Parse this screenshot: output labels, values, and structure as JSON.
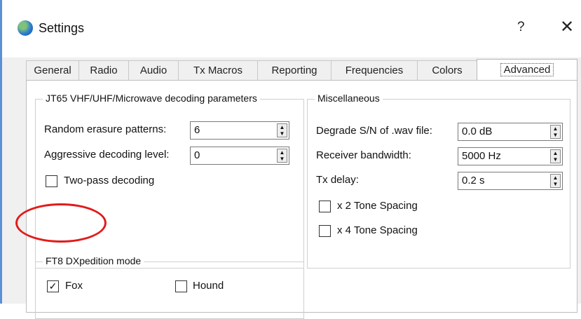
{
  "window": {
    "title": "Settings",
    "help_label": "?",
    "close_label": "✕"
  },
  "tabs": [
    {
      "label": "General",
      "active": false
    },
    {
      "label": "Radio",
      "active": false
    },
    {
      "label": "Audio",
      "active": false
    },
    {
      "label": "Tx Macros",
      "active": false
    },
    {
      "label": "Reporting",
      "active": false
    },
    {
      "label": "Frequencies",
      "active": false
    },
    {
      "label": "Colors",
      "active": false
    },
    {
      "label": "Advanced",
      "active": true
    }
  ],
  "jt65_group": {
    "title": "JT65 VHF/UHF/Microwave decoding parameters",
    "random_erasure_label": "Random erasure patterns:",
    "random_erasure_value": "6",
    "aggressive_label": "Aggressive decoding level:",
    "aggressive_value": "0",
    "two_pass_label": "Two-pass decoding",
    "two_pass_checked": false
  },
  "misc_group": {
    "title": "Miscellaneous",
    "degrade_label": "Degrade S/N of .wav file:",
    "degrade_value": "0.0 dB",
    "bandwidth_label": "Receiver bandwidth:",
    "bandwidth_value": "5000 Hz",
    "txdelay_label": "Tx delay:",
    "txdelay_value": "0.2 s",
    "x2_label": "x 2 Tone Spacing",
    "x2_checked": false,
    "x4_label": "x 4 Tone Spacing",
    "x4_checked": false
  },
  "ft8_group": {
    "title": "FT8 DXpedition mode",
    "fox_label": "Fox",
    "fox_checked": true,
    "fox_mark": "✓",
    "hound_label": "Hound",
    "hound_checked": false
  },
  "colors": {
    "accent": "#5b8fd6",
    "highlight_circle": "#e11b1b"
  }
}
